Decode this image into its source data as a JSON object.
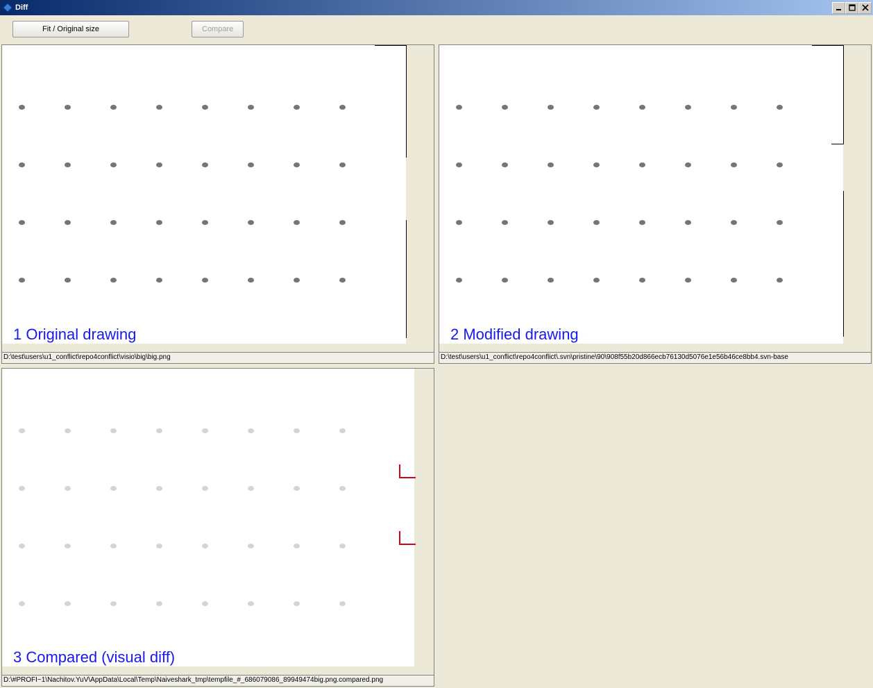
{
  "window": {
    "title": "Diff"
  },
  "toolbar": {
    "fit_label": "Fit / Original size",
    "compare_label": "Compare"
  },
  "panels": {
    "original": {
      "label": "1 Original drawing",
      "path": "D:\\test\\users\\u1_conflict\\repo4conflict\\visio\\big\\big.png"
    },
    "modified": {
      "label": "2 Modified drawing",
      "path": "D:\\test\\users\\u1_conflict\\repo4conflict\\.svn\\pristine\\90\\908f55b20d866ecb76130d5076e1e56b46ce8bb4.svn-base"
    },
    "compared": {
      "label": "3 Compared (visual diff)",
      "path": "D:\\#PROFI~1\\Nachitov.YuV\\AppData\\Local\\Temp\\Naiveshark_tmp\\tempfile_#_686079086_89949474big.png.compared.png"
    }
  }
}
